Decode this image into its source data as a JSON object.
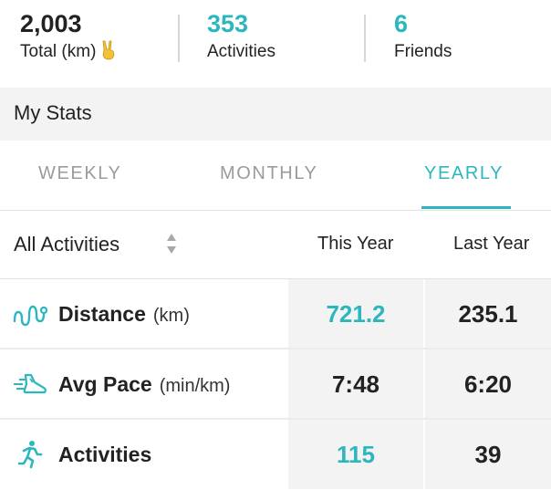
{
  "summary": {
    "total": {
      "value": "2,003",
      "label": "Total (km)"
    },
    "activities": {
      "value": "353",
      "label": "Activities"
    },
    "friends": {
      "value": "6",
      "label": "Friends"
    }
  },
  "section_title": "My Stats",
  "tabs": [
    {
      "label": "WEEKLY",
      "active": false
    },
    {
      "label": "MONTHLY",
      "active": false
    },
    {
      "label": "YEARLY",
      "active": true
    }
  ],
  "table": {
    "filter_label": "All Activities",
    "columns": [
      "This Year",
      "Last Year"
    ],
    "rows": [
      {
        "icon": "route-icon",
        "label": "Distance",
        "unit": "(km)",
        "this_year": "721.2",
        "last_year": "235.1",
        "highlight": true
      },
      {
        "icon": "shoe-speed-icon",
        "label": "Avg Pace",
        "unit": "(min/km)",
        "this_year": "7:48",
        "last_year": "6:20",
        "highlight": false
      },
      {
        "icon": "runner-icon",
        "label": "Activities",
        "unit": "",
        "this_year": "115",
        "last_year": "39",
        "highlight": true
      }
    ]
  },
  "colors": {
    "accent": "#2bb7bd",
    "text": "#222222",
    "muted": "#9b9b9b",
    "panel": "#f3f3f3"
  }
}
